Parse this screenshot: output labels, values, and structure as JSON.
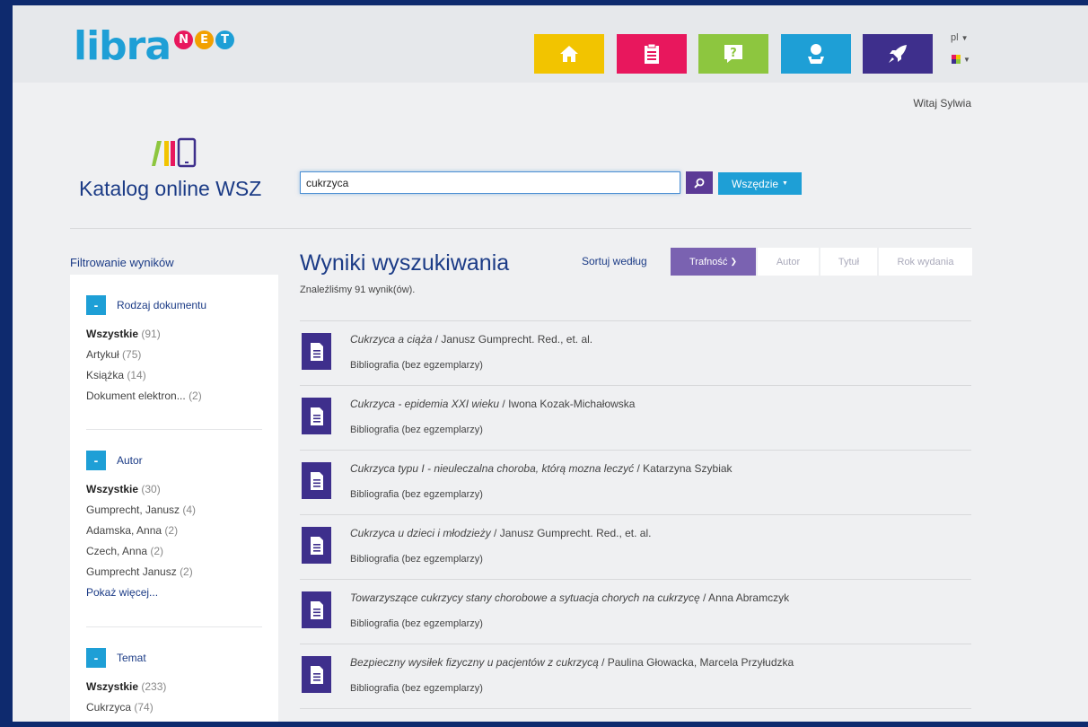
{
  "header": {
    "logo_text": "libra",
    "logo_net": [
      "N",
      "E",
      "T"
    ],
    "lang": "pl",
    "nav": [
      {
        "name": "home",
        "color": "#f2c400",
        "icon": "home-icon"
      },
      {
        "name": "clipboard",
        "color": "#e8175d",
        "icon": "clipboard-icon"
      },
      {
        "name": "help",
        "color": "#8dc63f",
        "icon": "question-icon"
      },
      {
        "name": "user",
        "color": "#1e9fd6",
        "icon": "user-icon"
      },
      {
        "name": "rocket",
        "color": "#3e2f8c",
        "icon": "rocket-icon"
      }
    ]
  },
  "welcome": "Witaj Sylwia",
  "catalog_title": "Katalog online WSZ",
  "search": {
    "value": "cukrzyca",
    "scope": "Wszędzie"
  },
  "filters": {
    "heading": "Filtrowanie wyników",
    "groups": [
      {
        "title": "Rodzaj dokumentu",
        "items": [
          {
            "label": "Wszystkie",
            "count": "(91)"
          },
          {
            "label": "Artykuł",
            "count": "(75)"
          },
          {
            "label": "Książka",
            "count": "(14)"
          },
          {
            "label": "Dokument elektron...",
            "count": "(2)"
          }
        ]
      },
      {
        "title": "Autor",
        "items": [
          {
            "label": "Wszystkie",
            "count": "(30)"
          },
          {
            "label": "Gumprecht, Janusz",
            "count": "(4)"
          },
          {
            "label": "Adamska, Anna",
            "count": "(2)"
          },
          {
            "label": "Czech, Anna",
            "count": "(2)"
          },
          {
            "label": "Gumprecht Janusz",
            "count": "(2)"
          }
        ],
        "more": "Pokaż więcej..."
      },
      {
        "title": "Temat",
        "items": [
          {
            "label": "Wszystkie",
            "count": "(233)"
          },
          {
            "label": "Cukrzyca",
            "count": "(74)"
          }
        ]
      }
    ]
  },
  "results": {
    "title": "Wyniki wyszukiwania",
    "count_text": "Znaleźliśmy 91 wynik(ów).",
    "sort_label": "Sortuj według",
    "sort_options": [
      "Trafność",
      "Autor",
      "Tytuł",
      "Rok wydania"
    ],
    "items": [
      {
        "title": "Cukrzyca a ciąża",
        "author": " / Janusz Gumprecht. Red., et. al.",
        "type": "Bibliografia (bez egzemplarzy)"
      },
      {
        "title": "Cukrzyca - epidemia XXI wieku",
        "author": " / Iwona Kozak-Michałowska",
        "type": "Bibliografia (bez egzemplarzy)"
      },
      {
        "title": "Cukrzyca typu I - nieuleczalna choroba, którą mozna leczyć",
        "author": " / Katarzyna Szybiak",
        "type": "Bibliografia (bez egzemplarzy)"
      },
      {
        "title": "Cukrzyca u dzieci i młodzieży",
        "author": " / Janusz Gumprecht. Red., et. al.",
        "type": "Bibliografia (bez egzemplarzy)"
      },
      {
        "title": "Towarzyszące cukrzycy stany chorobowe a sytuacja chorych na cukrzycę",
        "author": " / Anna Abramczyk",
        "type": "Bibliografia (bez egzemplarzy)"
      },
      {
        "title": "Bezpieczny wysiłek fizyczny u pacjentów z cukrzycą",
        "author": " / Paulina Głowacka, Marcela Przyłudzka",
        "type": "Bibliografia (bez egzemplarzy)"
      }
    ]
  }
}
